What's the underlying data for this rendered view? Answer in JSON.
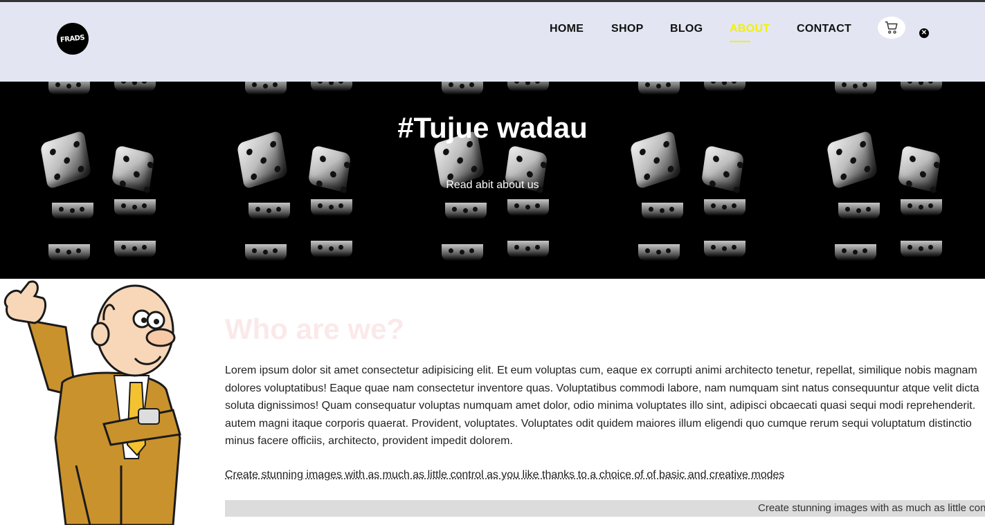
{
  "header": {
    "logo_text": "FRADS",
    "nav": [
      "HOME",
      "SHOP",
      "BLOG",
      "ABOUT",
      "CONTACT"
    ],
    "active_nav": "ABOUT",
    "accent_color": "#f2f200",
    "background": "#e3e6f2",
    "cart_icon": "cart-icon",
    "close_icon": "close-icon"
  },
  "hero": {
    "title": "#Tujue wadau",
    "subtitle": "Read abit about us",
    "background_pattern": "dice"
  },
  "about": {
    "heading": "Who are we?",
    "paragraph_lines": [
      "Lorem ipsum dolor sit amet consectetur adipisicing elit. Et eum voluptas cum, eaque ex corrupti animi architecto tenetur, repellat, similique nobis magnam",
      "dolores voluptatibus! Eaque quae nam consectetur inventore quas. Voluptatibus commodi labore, nam numquam sint natus consequuntur atque velit dicta",
      "soluta dignissimos! Quam consequatur voluptas numquam amet dolor, odio minima voluptates illo sint, adipisci obcaecati quasi sequi modi reprehenderit.",
      "autem magni itaque corporis quaerat. Provident, voluptates. Voluptates odit quidem maiores illum eligendi quo cumque rerum sequi voluptatum distinctio",
      "minus facere officiis, architecto, provident impedit dolorem."
    ],
    "link_text": "Create stunning images with as much as little control as you like thanks to a choice of of basic and creative modes",
    "marquee_text": "Create stunning images with as much as little control as you like thanks to a choice of of basic and creative modes"
  }
}
